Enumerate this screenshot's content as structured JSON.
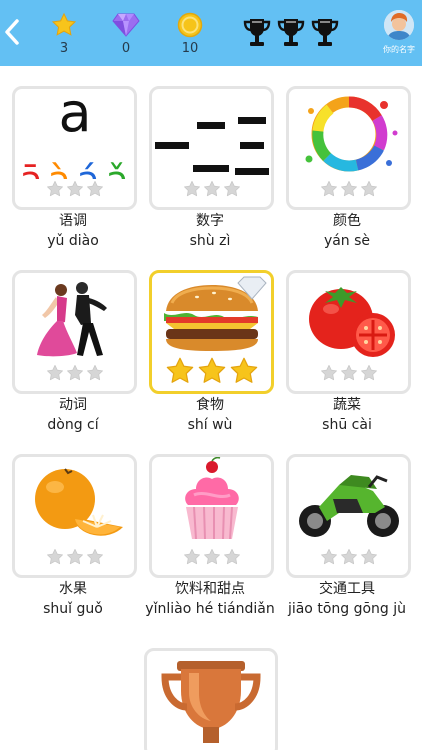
{
  "header": {
    "stars_count": "3",
    "gems_count": "0",
    "coins_count": "10",
    "profile_name": "你的名字"
  },
  "colors": {
    "header_bg": "#63c0f3",
    "selected_border": "#f2cf2b",
    "star_gold": "#f7c41b",
    "star_empty": "#d6d6d6"
  },
  "icons": [
    "back-chevron-icon",
    "star-icon",
    "gem-icon",
    "coin-icon",
    "trophy-icon",
    "avatar-icon"
  ],
  "categories": [
    {
      "title": "语调",
      "pinyin": "yǔ diào",
      "stars": 0,
      "art_text": {
        "big_letter": "a",
        "tones": [
          "ā",
          "à",
          "á",
          "ǎ"
        ]
      }
    },
    {
      "title": "数字",
      "pinyin": "shù zì",
      "stars": 0
    },
    {
      "title": "颜色",
      "pinyin": "yán sè",
      "stars": 0
    },
    {
      "title": "动词",
      "pinyin": "dòng cí",
      "stars": 0
    },
    {
      "title": "食物",
      "pinyin": "shí wù",
      "stars": 3
    },
    {
      "title": "蔬菜",
      "pinyin": "shū cài",
      "stars": 0
    },
    {
      "title": "水果",
      "pinyin": "shuǐ guǒ",
      "stars": 0
    },
    {
      "title": "饮料和甜点",
      "pinyin": "yǐnliào hé tiándiǎn",
      "stars": 0
    },
    {
      "title": "交通工具",
      "pinyin": "jiāo tōng gōng jù",
      "stars": 0
    }
  ]
}
